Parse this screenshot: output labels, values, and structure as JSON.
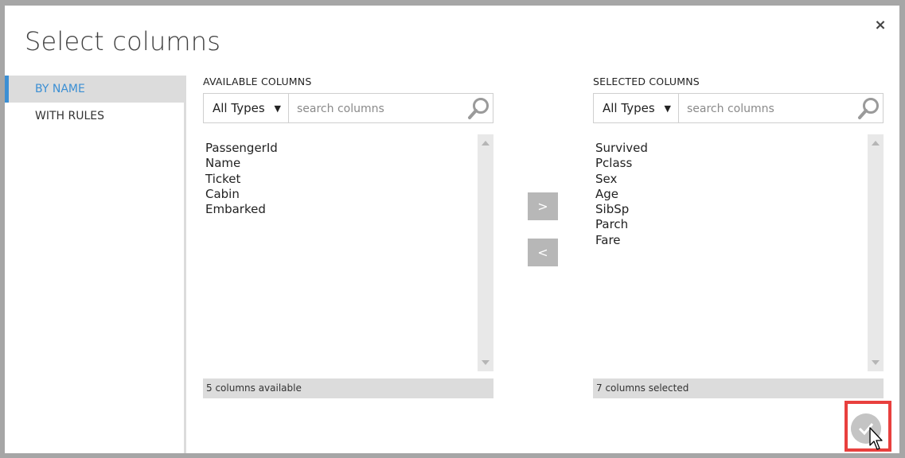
{
  "dialog": {
    "title": "Select columns",
    "close_label": "×",
    "ok_icon": "checkmark-icon"
  },
  "nav": {
    "items": [
      {
        "label": "BY NAME",
        "active": true
      },
      {
        "label": "WITH RULES",
        "active": false
      }
    ]
  },
  "available": {
    "header": "AVAILABLE COLUMNS",
    "type_filter": "All Types",
    "search_placeholder": "search columns",
    "columns": [
      "PassengerId",
      "Name",
      "Ticket",
      "Cabin",
      "Embarked"
    ],
    "status": "5 columns available"
  },
  "selected": {
    "header": "SELECTED COLUMNS",
    "type_filter": "All Types",
    "search_placeholder": "search columns",
    "columns": [
      "Survived",
      "Pclass",
      "Sex",
      "Age",
      "SibSp",
      "Parch",
      "Fare"
    ],
    "status": "7 columns selected"
  },
  "actions": {
    "add_label": ">",
    "remove_label": "<"
  },
  "colors": {
    "accent": "#3b8fd4",
    "highlight": "#e8403e",
    "button": "#b7b7b7"
  }
}
